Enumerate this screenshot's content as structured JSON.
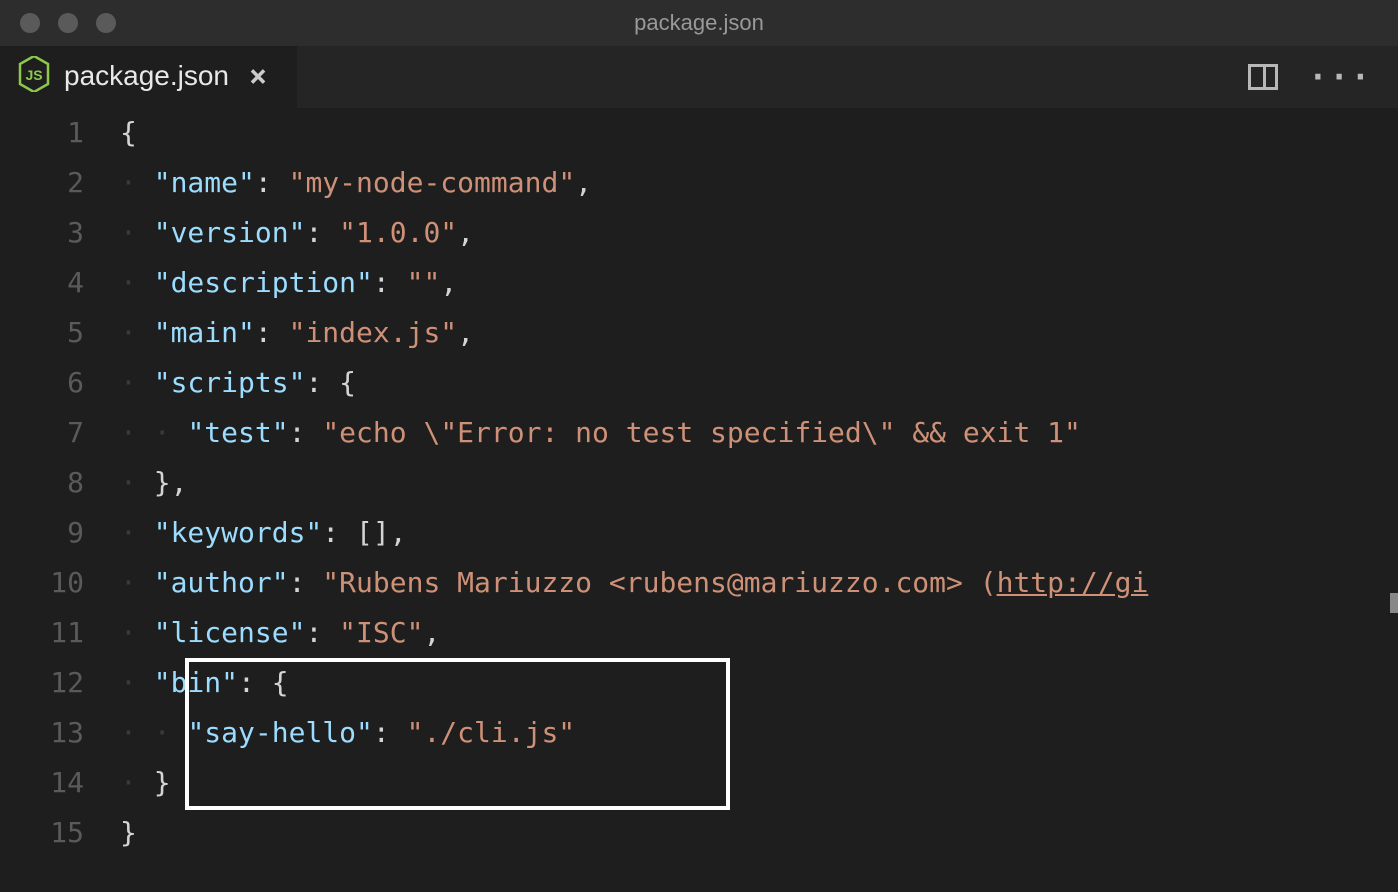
{
  "window": {
    "title": "package.json"
  },
  "tab": {
    "label": "package.json",
    "icon": "nodejs-icon"
  },
  "code": {
    "lines": [
      {
        "n": 1,
        "indent": 0,
        "tokens": [
          {
            "t": "brace",
            "v": "{"
          }
        ]
      },
      {
        "n": 2,
        "indent": 1,
        "tokens": [
          {
            "t": "key",
            "v": "\"name\""
          },
          {
            "t": "colon",
            "v": ": "
          },
          {
            "t": "str",
            "v": "\"my-node-command\""
          },
          {
            "t": "punct",
            "v": ","
          }
        ]
      },
      {
        "n": 3,
        "indent": 1,
        "tokens": [
          {
            "t": "key",
            "v": "\"version\""
          },
          {
            "t": "colon",
            "v": ": "
          },
          {
            "t": "str",
            "v": "\"1.0.0\""
          },
          {
            "t": "punct",
            "v": ","
          }
        ]
      },
      {
        "n": 4,
        "indent": 1,
        "tokens": [
          {
            "t": "key",
            "v": "\"description\""
          },
          {
            "t": "colon",
            "v": ": "
          },
          {
            "t": "str",
            "v": "\"\""
          },
          {
            "t": "punct",
            "v": ","
          }
        ]
      },
      {
        "n": 5,
        "indent": 1,
        "tokens": [
          {
            "t": "key",
            "v": "\"main\""
          },
          {
            "t": "colon",
            "v": ": "
          },
          {
            "t": "str",
            "v": "\"index.js\""
          },
          {
            "t": "punct",
            "v": ","
          }
        ]
      },
      {
        "n": 6,
        "indent": 1,
        "tokens": [
          {
            "t": "key",
            "v": "\"scripts\""
          },
          {
            "t": "colon",
            "v": ": "
          },
          {
            "t": "brace",
            "v": "{"
          }
        ]
      },
      {
        "n": 7,
        "indent": 2,
        "tokens": [
          {
            "t": "key",
            "v": "\"test\""
          },
          {
            "t": "colon",
            "v": ": "
          },
          {
            "t": "str",
            "v": "\"echo \\\"Error: no test specified\\\" && exit 1\""
          }
        ]
      },
      {
        "n": 8,
        "indent": 1,
        "tokens": [
          {
            "t": "brace",
            "v": "}"
          },
          {
            "t": "punct",
            "v": ","
          }
        ]
      },
      {
        "n": 9,
        "indent": 1,
        "tokens": [
          {
            "t": "key",
            "v": "\"keywords\""
          },
          {
            "t": "colon",
            "v": ": "
          },
          {
            "t": "punct",
            "v": "[],"
          }
        ]
      },
      {
        "n": 10,
        "indent": 1,
        "tokens": [
          {
            "t": "key",
            "v": "\"author\""
          },
          {
            "t": "colon",
            "v": ": "
          },
          {
            "t": "str",
            "v": "\"Rubens Mariuzzo <rubens@mariuzzo.com> ("
          },
          {
            "t": "link",
            "v": "http://gi"
          }
        ]
      },
      {
        "n": 11,
        "indent": 1,
        "tokens": [
          {
            "t": "key",
            "v": "\"license\""
          },
          {
            "t": "colon",
            "v": ": "
          },
          {
            "t": "str",
            "v": "\"ISC\""
          },
          {
            "t": "punct",
            "v": ","
          }
        ]
      },
      {
        "n": 12,
        "indent": 1,
        "tokens": [
          {
            "t": "key",
            "v": "\"bin\""
          },
          {
            "t": "colon",
            "v": ": "
          },
          {
            "t": "brace",
            "v": "{"
          }
        ]
      },
      {
        "n": 13,
        "indent": 2,
        "tokens": [
          {
            "t": "key",
            "v": "\"say-hello\""
          },
          {
            "t": "colon",
            "v": ": "
          },
          {
            "t": "str",
            "v": "\"./cli.js\""
          }
        ]
      },
      {
        "n": 14,
        "indent": 1,
        "tokens": [
          {
            "t": "brace",
            "v": "}"
          }
        ]
      },
      {
        "n": 15,
        "indent": 0,
        "tokens": [
          {
            "t": "brace",
            "v": "}"
          }
        ]
      }
    ]
  }
}
